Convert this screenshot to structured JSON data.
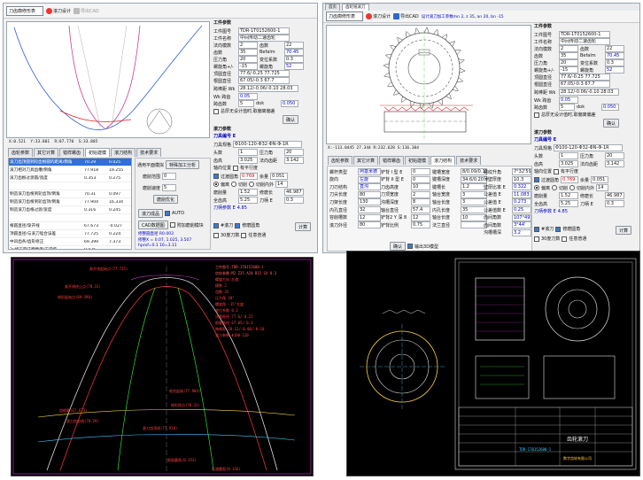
{
  "p1": {
    "toolbar": {
      "select": "刀齿廓修形表",
      "design": "滚刀设计",
      "export": "导出CAD"
    },
    "coords": {
      "x": "X:0.521",
      "y": "Y:33.801",
      "r": "R:87.770",
      "s": "S:33.805"
    },
    "tabs": [
      "齿轮参数",
      "其它计算",
      "错样螺齿",
      "初始建模",
      "滚刀结构",
      "技术要求"
    ],
    "list": [
      [
        "滚刀齿顶圆到轮齿根圆的距离/倒角",
        "70.29",
        "0.025"
      ],
      [
        "滚刀相对刀具齿槽/倒角",
        "77.918",
        "19.255"
      ],
      [
        "滚刀齿根过渡圆/宽度",
        "0.353",
        "0.275"
      ],
      [
        "",
        "",
        " "
      ],
      [
        "制造滚刀齿根到轮齿顶/倒角",
        "70.31",
        "0.097"
      ],
      [
        "制造滚刀齿根到轮齿顶/倒角",
        "77.904",
        "16.334"
      ],
      [
        "制造滚刀齿根过渡/宽度",
        "0.316",
        "0.245"
      ],
      [
        "",
        "",
        " "
      ],
      [
        "根圆直径/渐开线",
        "67.673",
        "-0.027"
      ],
      [
        "顶圆直径/与滚刀啮合误差",
        "77.725",
        "0.224"
      ],
      [
        "中凹齿条/齿形修正",
        "69.399",
        "7.373"
      ],
      [
        "3x修正圆法面精度/正常值",
        "0.025",
        ""
      ],
      [
        "30度切线包络偏差值",
        "2.34",
        "0"
      ]
    ],
    "opts": {
      "title": "通用平面模拟",
      "btn1": "特殊加工分析",
      "l1": "磨削范围",
      "v1": "0",
      "l2": "磨削速度",
      "v2": "5",
      "btn2": "磨削优化",
      "btn3": "滚刀成品",
      "auto": "AUTO",
      "btn4": "CAD数据图",
      "chk": "附加磨削模块"
    },
    "result": {
      "l1": "修整圆直径 R0.003",
      "l2": "修整X = 0.07, 1.025, 3.507",
      "l3": "hprof=0.1 16=3.11"
    },
    "right": {
      "title": "工件参数",
      "f1l": "工件图号",
      "f1": "TDR-1T0152600-1",
      "f2l": "工件名称",
      "f2": "中间传动二速齿轮",
      "mn_l": "法向模数",
      "mn": "2",
      "z2_l": "齿数",
      "z2": "22",
      "z_l": "齿数",
      "z": "35",
      "bn_l": "Befalm",
      "bn": "70.45",
      "a_l": "压力角",
      "a": "20",
      "x_l": "变位系数",
      "x": "0.3",
      "b_l": "螺旋角+/-",
      "b": "-15",
      "bd_l": "螺旋角",
      "bd": "52",
      "tip_l": "顶圆直径",
      "tip": "77.6/-0.25 77.725",
      "root_l": "根圆直径",
      "root": "67.05/-0.3 67.7",
      "span_l": "跨棒距 Wk",
      "span": "28.12/-0.06/-0.10 28.03",
      "wk_l": "Wk 跨齿",
      "wk": "0.05",
      "ang_l": "跨齿数",
      "ang": "5",
      "dk_l": "dok",
      "dk": "0.050",
      "chk": "总厚无设计值时,取偏离偏差",
      "btn": "确认",
      "hob_title": "滚刀参数",
      "hob_no": "刀具编号 E",
      "hob_sp": "刀具规格",
      "hob_spv": "Φ100-120-Φ32-ΦN-Φ-1R",
      "head_l": "头数",
      "head": "1",
      "ma_l": "压力角",
      "ma": "20",
      "len_l": "齿高",
      "len": "3.025",
      "ld_l": "法向齿距",
      "ld": "3.142",
      "ao_l": "轴向位置",
      "chk_l": "有平行度",
      "m1_l": "过渡圆角",
      "m1": "0.769",
      "m2_l": "余量",
      "m2": "0.051",
      "r1": "偏离",
      "r2": "切削",
      "r3": "切削内外",
      "r3v": "14",
      "k1_l": "磨削量",
      "k1": "1.52",
      "k2_l": "修磨长",
      "k2": "46.987",
      "k3_l": "全齿高",
      "k3": "5.25",
      "k4_l": "刀柄 E",
      "k4": "0.3",
      "tool_l": "刀柄参数 E",
      "tool": "4.85",
      "chk2": "#滚刀",
      "chk3": "修磨圆角",
      "chk4": "30度刀数",
      "chk5": "任意普通",
      "calc": "计算"
    }
  },
  "p2": {
    "tabs": [
      "首页",
      "齿轮铣滚刀"
    ],
    "toolbar": {
      "select": "刀齿廓修形表",
      "design": "滚刀设计",
      "export": "导出CAD",
      "info": "设计滚刀加工参数mn 2, z 35, an 20, bn -15"
    },
    "coords": "X:-113.0445 27.344  R:232.628  S:116.304",
    "tabs2": [
      "齿轮参数",
      "其它计算",
      "错样螺齿",
      "初始建模",
      "滚刀结构",
      "技术要求"
    ],
    "c1": [
      [
        "螺杆类型",
        "阿基米德"
      ],
      [
        "旋向",
        "左旋"
      ],
      [
        "刀刃结构",
        "直沟"
      ],
      [
        "刀尖长度",
        "80"
      ],
      [
        "刀架长度",
        "130"
      ],
      [
        "内孔直径",
        "32"
      ],
      [
        "容削槽数",
        "12"
      ],
      [
        "滚刀外径",
        "80"
      ]
    ],
    "c2": [
      [
        "铲背 I 型 E",
        "0"
      ],
      [
        "铲背 II 型 E",
        "0"
      ],
      [
        "刀齿高度",
        "10"
      ],
      [
        "刀顶宽度",
        "2"
      ],
      [
        "沟槽深度",
        "8"
      ],
      [
        "轴台直径",
        "57.4"
      ],
      [
        "铲背2 Y 深 8",
        "12"
      ],
      [
        "铲背比例",
        "0.75"
      ]
    ],
    "c3": [
      [
        "键槽宽度",
        "8/0.09/0.1T"
      ],
      [
        "键槽深度",
        "34.6/0.20"
      ],
      [
        "键槽长",
        "1.2"
      ],
      [
        "轴台宽度",
        "3"
      ],
      [
        "轴台长度",
        "3"
      ],
      [
        "内孔长度",
        "35"
      ],
      [
        "轴台长度",
        "10"
      ],
      [
        "法兰直径",
        ""
      ]
    ],
    "c4": [
      [
        "螺纹升角",
        "7°32'59\""
      ],
      [
        "薄壁厚度",
        "10.3"
      ],
      [
        "壁厚比率 E",
        "0.322"
      ],
      [
        "公差值 E",
        "11.083"
      ],
      [
        "公差值 E",
        "0.273"
      ],
      [
        "公差值数 E",
        "0.25"
      ],
      [
        "齿间角数",
        "107°49'"
      ],
      [
        "齿间角数",
        "3°44'"
      ],
      [
        "沟槽槽深",
        "3.2"
      ]
    ],
    "btn": "确认",
    "chk": "输出3D模型",
    "right": {
      "f1": "TDR-1T0152600-1",
      "f2": "中间传动二速齿轮",
      "mn": "2",
      "z2": "22",
      "z": "35",
      "bn": "70.45",
      "a": "20",
      "x": "0.3",
      "b": "-15",
      "bd": "52",
      "tip": "77.6/-0.25 77.725",
      "root": "67.05/-0.3 67.7",
      "span": "28.12/-0.06/-0.10 28.03",
      "wk": "0.05",
      "ang": "5",
      "dk": "0.050",
      "hob_spv": "Φ100-120-Φ32-ΦN-Φ-1R",
      "head": "1",
      "ma": "20",
      "len": "3.025",
      "ld": "3.142",
      "m1": "0.769",
      "m2": "0.051",
      "r3v": "14",
      "k1": "1.52",
      "k2": "46.987",
      "k3": "5.25",
      "k4": "0.3",
      "tool": "4.85"
    }
  },
  "p3": {
    "notes": [
      "工件图号:TDR-1T0152600-1",
      "齿轮参数:M2 Z35 A20 B15 SX 0.3",
      "螺旋方向:左旋",
      "模数 2",
      "齿数 35",
      "压力角 20°",
      "螺旋角 -15°左旋",
      "变位系数 0.3",
      "顶圆直径 77.6/-0.25",
      "根圆直径 67.05/-0.3",
      "跨棒距 28.12/-0.06/-0.10",
      "滚刀参数 Φ100-120"
    ],
    "labels": [
      "渐开线起始点(77.725)",
      "渐开线终止点(70.31)",
      "修形起始点(69.399)",
      "齿根圆(67.673)",
      "滚刀齿根线(70.29)",
      "滚刀齿顶线(77.918)",
      "啮合起始(77.904)",
      "修形终点(70.31)",
      "根部圆角(0.353)",
      "过渡圆弧(0.316)"
    ]
  },
  "p4": {
    "title": "齿轮滚刀",
    "company": "数字齿轮有限公司",
    "drawno": "TDR-1T0152600-1"
  }
}
